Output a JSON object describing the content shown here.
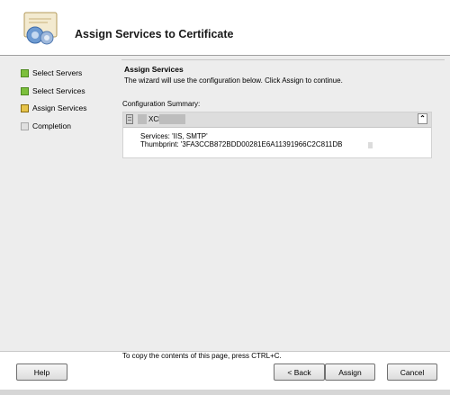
{
  "header": {
    "title": "Assign Services to Certificate",
    "icon": "certificate-wizard-icon"
  },
  "nav": {
    "items": [
      {
        "label": "Select Servers",
        "status": "done"
      },
      {
        "label": "Select Services",
        "status": "done"
      },
      {
        "label": "Assign Services",
        "status": "current"
      },
      {
        "label": "Completion",
        "status": "pending"
      }
    ]
  },
  "main": {
    "section_title": "Assign Services",
    "description": "The wizard will use the configuration below.  Click Assign to continue.",
    "config_label": "Configuration Summary:",
    "summary": {
      "server_name_visible": "XCH",
      "services": "Services: 'IIS, SMTP'",
      "thumbprint": "Thumbprint: '3FA3CCB872BDD00281E6A11391966C2C811DB",
      "collapse_glyph": "⌃"
    }
  },
  "footer": {
    "copy_hint": "To copy the contents of this page, press CTRL+C.",
    "help_label": "Help",
    "back_label": "< Back",
    "assign_label": "Assign",
    "cancel_label": "Cancel"
  },
  "colors": {
    "done": "#7cbf3c",
    "current": "#e6c34a",
    "pending": "#e0e0e0",
    "panel_bg": "#ededed"
  }
}
